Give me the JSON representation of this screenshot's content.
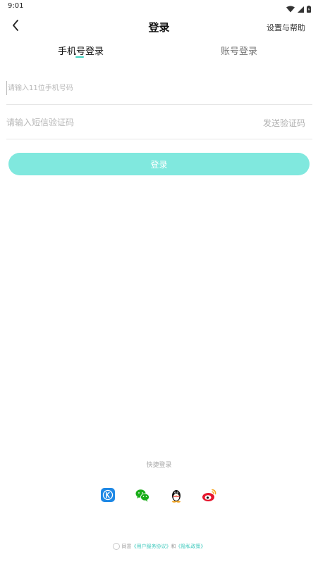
{
  "status_bar": {
    "time": "9:01"
  },
  "header": {
    "title": "登录",
    "help_label": "设置与帮助"
  },
  "tabs": [
    {
      "label": "手机号登录",
      "active": true
    },
    {
      "label": "账号登录",
      "active": false
    }
  ],
  "form": {
    "phone_placeholder": "请输入11位手机号码",
    "phone_value": "",
    "code_placeholder": "请输入短信验证码",
    "code_value": "",
    "send_code_label": "发送验证码",
    "login_label": "登录"
  },
  "quick_login": {
    "label": "快捷登录",
    "providers": [
      "k-app-icon",
      "wechat-icon",
      "qq-icon",
      "weibo-icon"
    ]
  },
  "agreement": {
    "prefix": "同意",
    "terms": "《用户服务协议》",
    "conjunction": "和",
    "privacy": "《隐私政策》"
  },
  "colors": {
    "accent": "#3fd3c0",
    "button": "#80e8de",
    "k_app": "#1e88e5",
    "wechat": "#1aad19",
    "weibo": "#e6162d"
  }
}
